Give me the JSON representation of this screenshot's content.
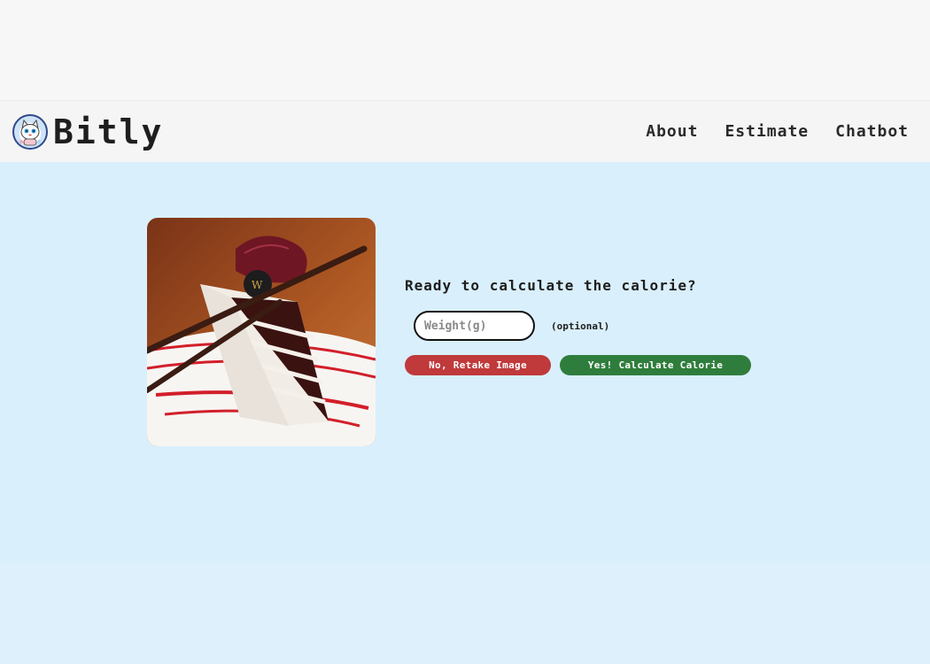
{
  "navbar": {
    "brand": "Bitly",
    "links": [
      "About",
      "Estimate",
      "Chatbot"
    ]
  },
  "main": {
    "question": "Ready to calculate the calorie?",
    "weight_placeholder": "Weight(g)",
    "weight_value": "",
    "optional_label": "(optional)",
    "retake_label": "No, Retake Image",
    "calculate_label": "Yes! Calculate Calorie"
  },
  "colors": {
    "main_bg": "#d9effc",
    "retake_button": "#c0393b",
    "calculate_button": "#2f7d3c"
  },
  "icons": {
    "logo": "cat-mascot-icon"
  }
}
